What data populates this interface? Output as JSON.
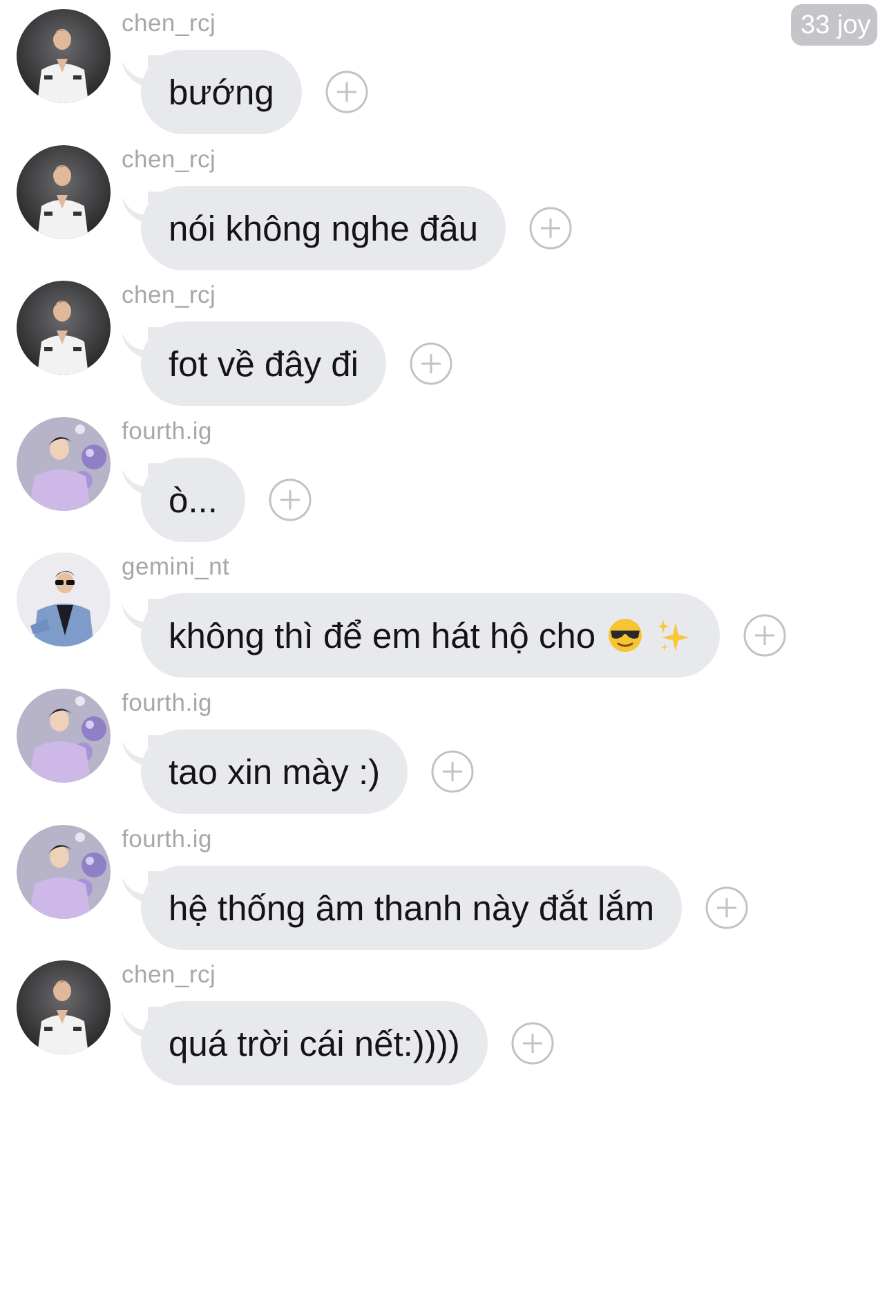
{
  "badge": {
    "text": "33 joy"
  },
  "colors": {
    "bubble": "#e8e9ec",
    "username": "#a6a6ab",
    "message_text": "#141416",
    "plus_icon": "#c2c2c6",
    "badge_bg": "#c5c5c9"
  },
  "messages": [
    {
      "user": "chen_rcj",
      "avatar": "avatar-chen",
      "text": "bướng",
      "emoji": []
    },
    {
      "user": "chen_rcj",
      "avatar": "avatar-chen",
      "text": "nói không nghe đâu",
      "emoji": []
    },
    {
      "user": "chen_rcj",
      "avatar": "avatar-chen",
      "text": "fot về đây đi",
      "emoji": []
    },
    {
      "user": "fourth.ig",
      "avatar": "avatar-fourth",
      "text": "ò...",
      "emoji": []
    },
    {
      "user": "gemini_nt",
      "avatar": "avatar-gemini",
      "text": "không thì để em hát hộ cho",
      "emoji": [
        "sunglasses-emoji",
        "sparkles-emoji"
      ]
    },
    {
      "user": "fourth.ig",
      "avatar": "avatar-fourth",
      "text": "tao xin mày :)",
      "emoji": []
    },
    {
      "user": "fourth.ig",
      "avatar": "avatar-fourth",
      "text": "hệ thống âm thanh này đắt lắm",
      "emoji": []
    },
    {
      "user": "chen_rcj",
      "avatar": "avatar-chen",
      "text": "quá trời cái nết:))))",
      "emoji": []
    }
  ]
}
